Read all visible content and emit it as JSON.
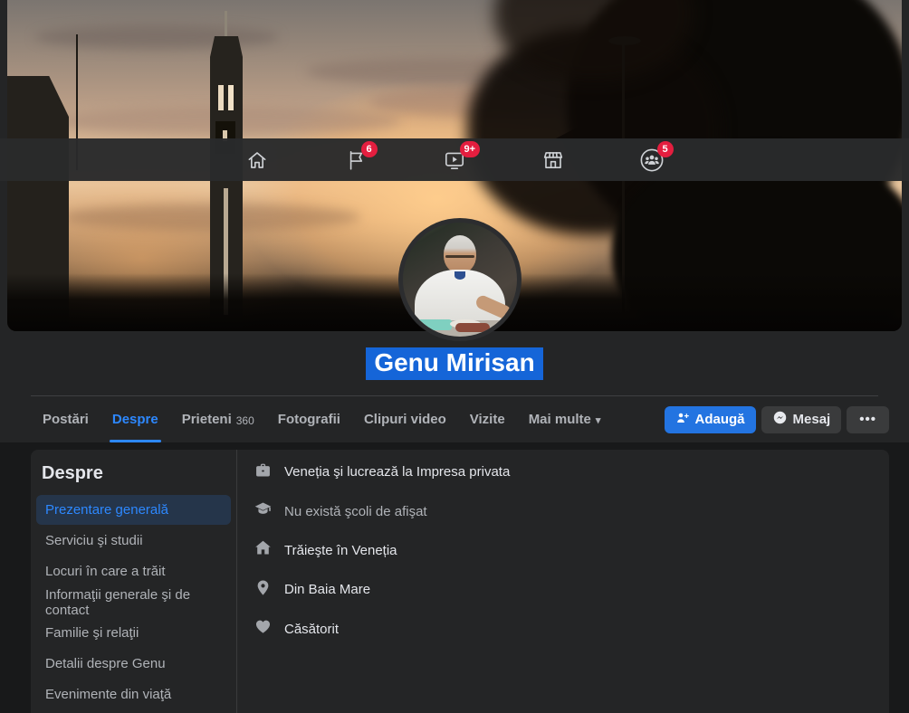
{
  "colors": {
    "accent_blue": "#2d88ff",
    "primary_button_blue": "#2374e1",
    "badge_red": "#e41e3f",
    "name_selection_blue": "#1565d8",
    "card_background": "#242526",
    "page_background": "#18191a"
  },
  "top_nav": {
    "items": [
      {
        "icon": "home-icon",
        "badge": ""
      },
      {
        "icon": "pages-flag-icon",
        "badge": "6"
      },
      {
        "icon": "watch-icon",
        "badge": "9+"
      },
      {
        "icon": "marketplace-icon",
        "badge": ""
      },
      {
        "icon": "groups-icon",
        "badge": "5"
      }
    ]
  },
  "profile": {
    "name": "Genu Mirisan"
  },
  "tabs": {
    "items": [
      {
        "label": "Postări"
      },
      {
        "label": "Despre",
        "active": true
      },
      {
        "label": "Prieteni",
        "count": "360"
      },
      {
        "label": "Fotografii"
      },
      {
        "label": "Clipuri video"
      },
      {
        "label": "Vizite"
      },
      {
        "label": "Mai multe",
        "caret": "▾"
      }
    ]
  },
  "actions": {
    "add": "Adaugă",
    "message": "Mesaj",
    "more": "•••"
  },
  "about": {
    "heading": "Despre",
    "nav": [
      {
        "label": "Prezentare generală",
        "active": true
      },
      {
        "label": "Serviciu şi studii"
      },
      {
        "label": "Locuri în care a trăit"
      },
      {
        "label": "Informaţii generale şi de contact"
      },
      {
        "label": "Familie şi relaţii"
      },
      {
        "label": "Detalii despre Genu"
      },
      {
        "label": "Evenimente din viaţă"
      }
    ],
    "overview": [
      {
        "icon": "briefcase-icon",
        "text": "Veneția şi lucrează la Impresa privata"
      },
      {
        "icon": "graduation-cap-icon",
        "text": "Nu există şcoli de afişat",
        "muted": true
      },
      {
        "icon": "house-icon",
        "text": "Trăieşte în Veneția"
      },
      {
        "icon": "location-pin-icon",
        "text": "Din Baia Mare"
      },
      {
        "icon": "heart-icon",
        "text": "Căsătorit"
      }
    ]
  }
}
